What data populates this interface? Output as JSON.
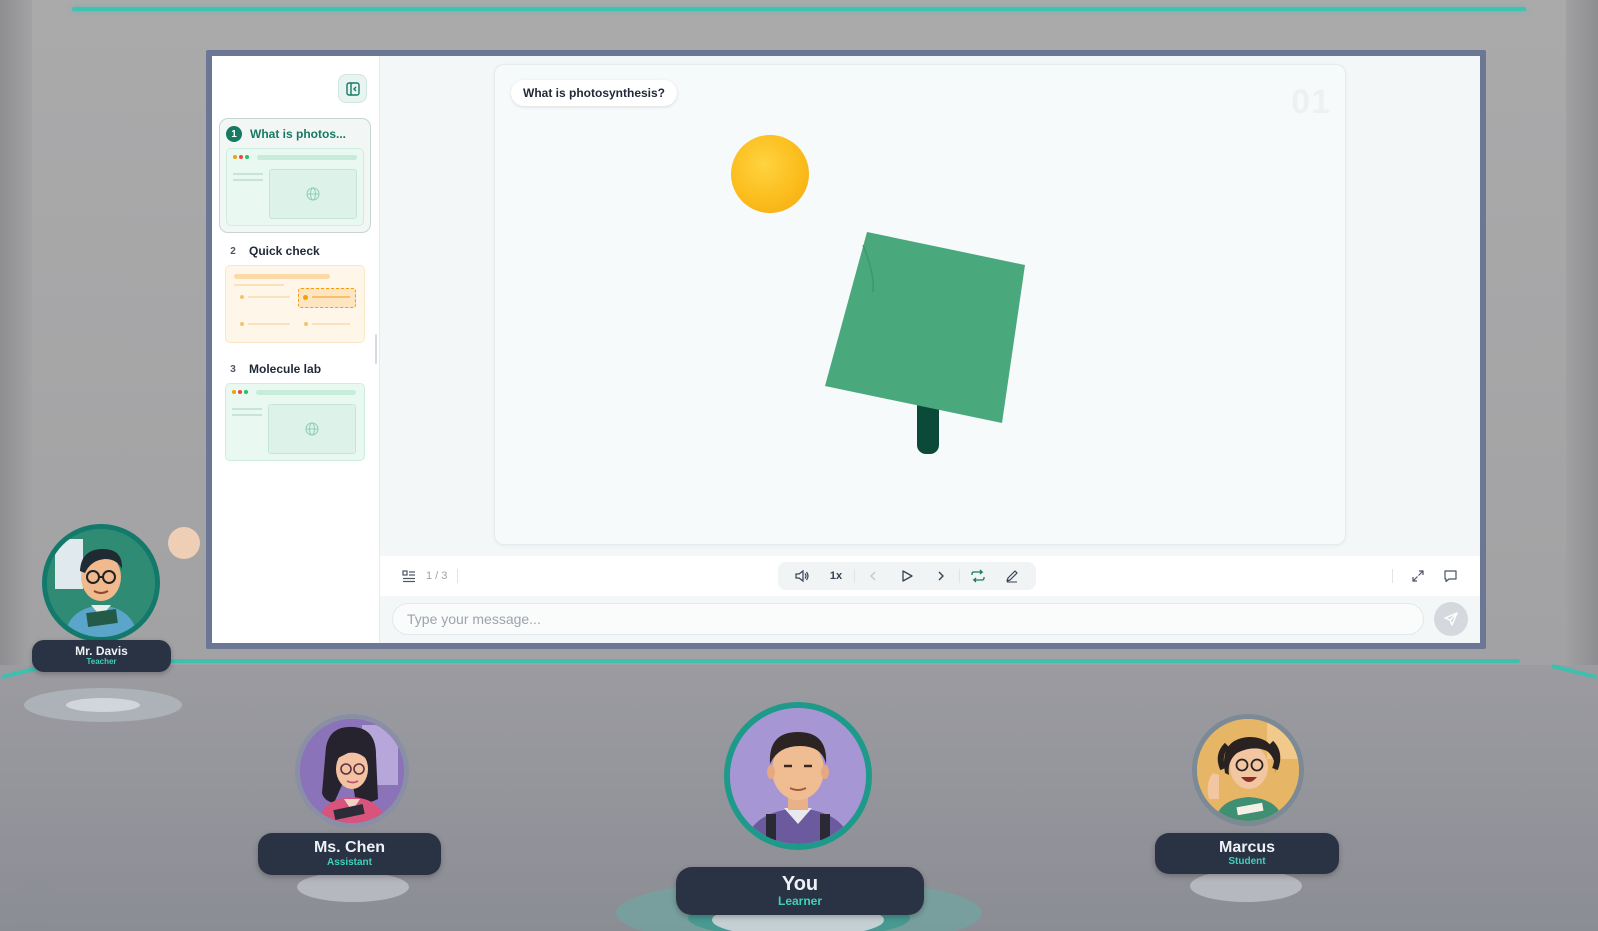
{
  "sidebar": {
    "slides": [
      {
        "number": "1",
        "title": "What is photos..."
      },
      {
        "number": "2",
        "title": "Quick check"
      },
      {
        "number": "3",
        "title": "Molecule lab"
      }
    ]
  },
  "stage": {
    "label": "What is photosynthesis?",
    "number": "01"
  },
  "controls": {
    "page_indicator": "1 / 3",
    "speed": "1x"
  },
  "chat": {
    "placeholder": "Type your message..."
  },
  "participants": {
    "teacher": {
      "name": "Mr. Davis",
      "role": "Teacher"
    },
    "assistant": {
      "name": "Ms. Chen",
      "role": "Assistant"
    },
    "you": {
      "name": "You",
      "role": "Learner"
    },
    "student": {
      "name": "Marcus",
      "role": "Student"
    }
  },
  "colors": {
    "accent": "#167a63",
    "teal_glow": "#3fc2b0",
    "leaf": "#4aa87d",
    "sun": "#fbbd1c",
    "nameplate": "#2a3344"
  },
  "icons": [
    "sidebar-collapse-icon",
    "globe-icon",
    "outline-list-icon",
    "speaker-icon",
    "chevron-left-icon",
    "play-icon",
    "chevron-right-icon",
    "repeat-icon",
    "pencil-icon",
    "fullscreen-icon",
    "chat-bubble-icon",
    "send-icon"
  ]
}
